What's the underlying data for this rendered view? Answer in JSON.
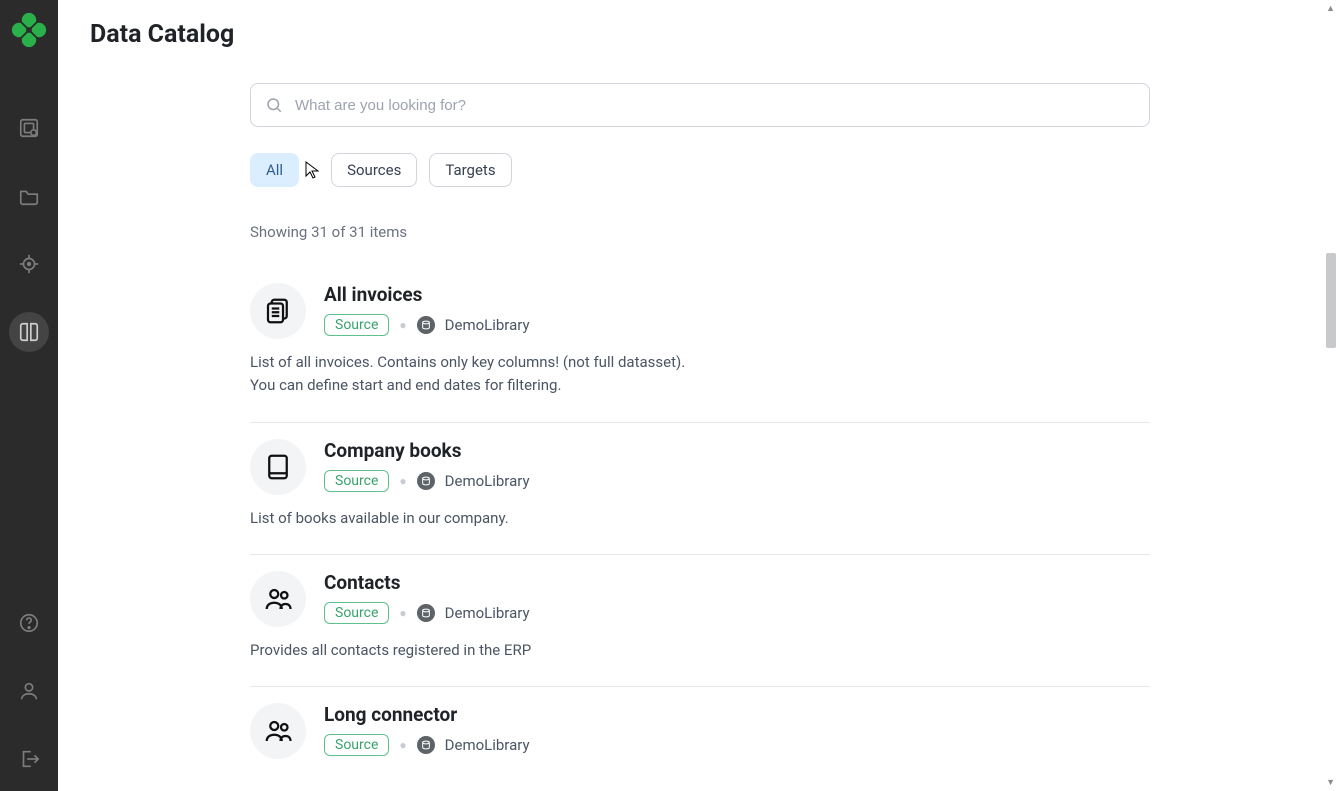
{
  "page_title": "Data Catalog",
  "search": {
    "placeholder": "What are you looking for?"
  },
  "filters": {
    "all": "All",
    "sources": "Sources",
    "targets": "Targets"
  },
  "count_text": "Showing 31 of 31 items",
  "library_name": "DemoLibrary",
  "source_badge": "Source",
  "items": [
    {
      "title": "All invoices",
      "desc": "List of all invoices. Contains only key columns! (not full datasset).\nYou can define start and end dates for filtering.",
      "icon": "document"
    },
    {
      "title": "Company books",
      "desc": "List of books available in our company.",
      "icon": "book"
    },
    {
      "title": "Contacts",
      "desc": "Provides all contacts registered in the ERP",
      "icon": "people"
    },
    {
      "title": "Long connector",
      "desc": "",
      "icon": "people"
    }
  ]
}
